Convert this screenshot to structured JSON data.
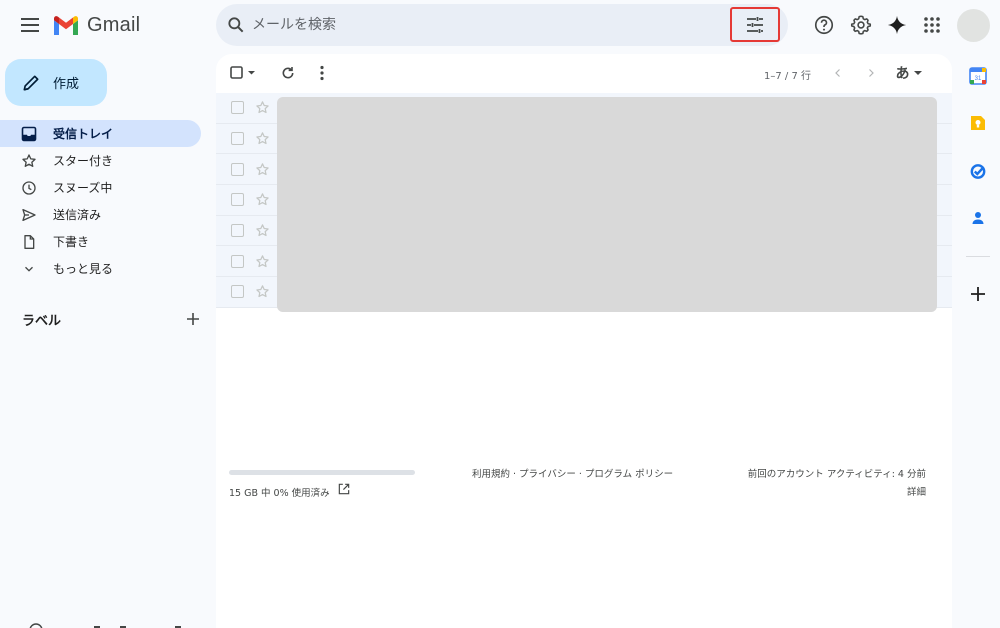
{
  "header": {
    "brand": "Gmail",
    "search_placeholder": "メールを検索"
  },
  "compose_label": "作成",
  "sidebar": {
    "items": [
      {
        "label": "受信トレイ",
        "icon": "inbox-icon",
        "active": true
      },
      {
        "label": "スター付き",
        "icon": "star-icon",
        "active": false
      },
      {
        "label": "スヌーズ中",
        "icon": "clock-icon",
        "active": false
      },
      {
        "label": "送信済み",
        "icon": "send-icon",
        "active": false
      },
      {
        "label": "下書き",
        "icon": "draft-icon",
        "active": false
      },
      {
        "label": "もっと見る",
        "icon": "chevron-down-icon",
        "active": false
      }
    ],
    "labels_title": "ラベル"
  },
  "toolbar": {
    "page_count": "1–7 / 7 行",
    "input_tool": "あ"
  },
  "mail_rows": [
    {
      "starred": false,
      "checked": false
    },
    {
      "starred": false,
      "checked": false
    },
    {
      "starred": false,
      "checked": false
    },
    {
      "starred": false,
      "checked": false
    },
    {
      "starred": false,
      "checked": false
    },
    {
      "starred": false,
      "checked": false
    },
    {
      "starred": false,
      "checked": false
    }
  ],
  "footer": {
    "storage_text": "15 GB 中 0% 使用済み",
    "storage_used_fraction": 0,
    "links": "利用規約 · プライバシー · プログラム ポリシー",
    "last_activity": "前回のアカウント アクティビティ: 4 分前",
    "details": "詳細"
  },
  "colors": {
    "compose_bg": "#c2e7ff",
    "active_nav_bg": "#d3e3fd",
    "search_bg": "#e9eef6",
    "highlight_border": "#e53935",
    "page_bg": "#f8fafd"
  }
}
